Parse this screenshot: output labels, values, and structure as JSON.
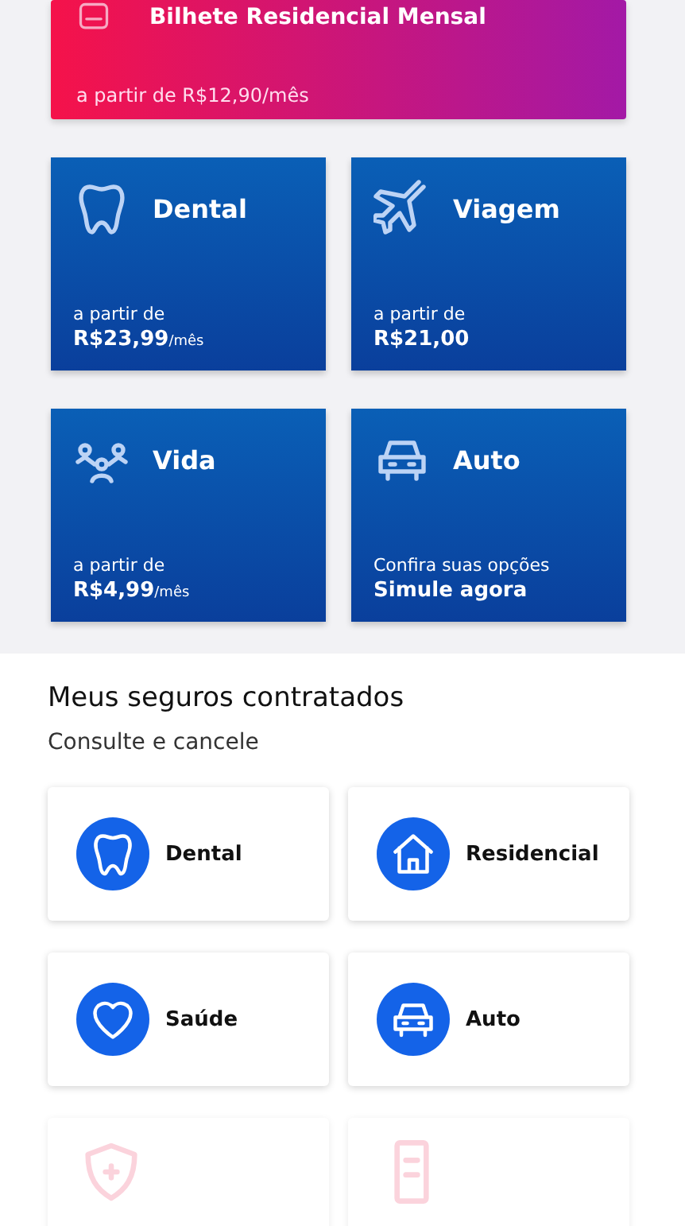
{
  "promo_banner": {
    "title": "Bilhete Residencial Mensal",
    "price": "a partir de R$12,90/mês"
  },
  "offers": [
    {
      "title": "Dental",
      "line_1": "a partir de",
      "line_2": "R$23,99",
      "suffix": "/mês"
    },
    {
      "title": "Viagem",
      "line_1": "a partir de",
      "line_2": "R$21,00"
    },
    {
      "title": "Vida",
      "line_1": "a partir de",
      "line_2": "R$4,99",
      "suffix": "/mês"
    },
    {
      "title": "Auto",
      "line_1": "Confira suas opções",
      "line_2": "Simule agora"
    }
  ],
  "my_insurance": {
    "title": "Meus seguros contratados",
    "subtitle": "Consulte e cancele",
    "items": [
      {
        "kind": "active",
        "label": "Dental"
      },
      {
        "kind": "active",
        "label": "Residencial"
      },
      {
        "kind": "active",
        "label": "Saúde"
      },
      {
        "kind": "active",
        "label": "Auto"
      },
      {
        "kind": "faded"
      },
      {
        "kind": "faded"
      }
    ]
  }
}
